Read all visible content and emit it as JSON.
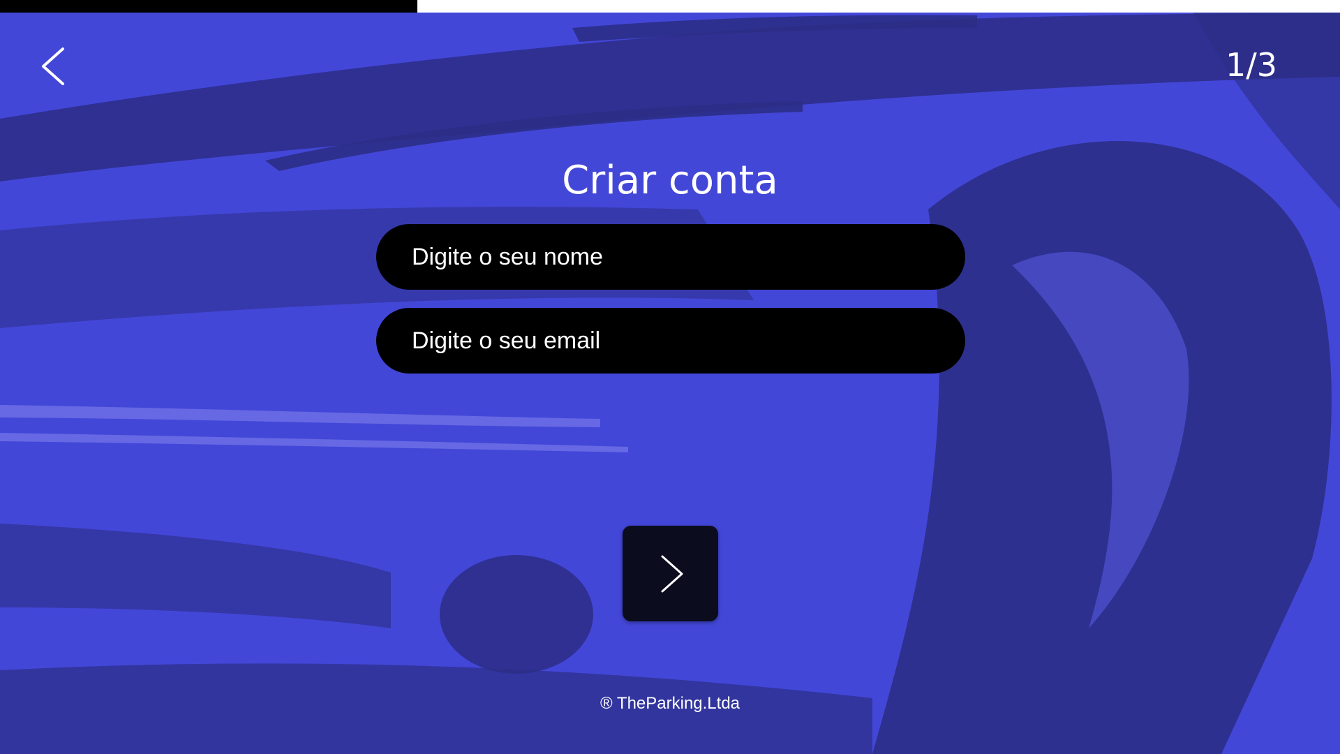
{
  "progress": {
    "fraction": 0.3115
  },
  "header": {
    "back_icon": "chevron-left-icon",
    "step": "1/3"
  },
  "form": {
    "title": "Criar conta",
    "name_placeholder": "Digite o seu nome",
    "email_placeholder": "Digite o seu email"
  },
  "next_button": {
    "icon": "chevron-right-icon"
  },
  "footer": {
    "text": "® TheParking.Ltda"
  },
  "colors": {
    "background": "#4347d8",
    "background_shadow": "#2b2d86",
    "field": "#000000",
    "next_button": "#0b0d1f",
    "text": "#ffffff"
  }
}
